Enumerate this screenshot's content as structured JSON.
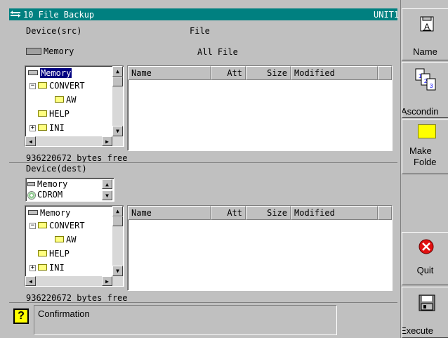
{
  "window": {
    "title": "10 File Backup",
    "unit": "UNIT1"
  },
  "source": {
    "device_label": "Device(src)",
    "file_label": "File",
    "device_value": "Memory",
    "file_value": "All File",
    "tree": [
      "Memory",
      "CONVERT",
      "AW",
      "HELP",
      "INI"
    ],
    "columns": [
      "Name",
      "Att",
      "Size",
      "Modified"
    ],
    "free": "936220672 bytes free"
  },
  "dest": {
    "device_label": "Device(dest)",
    "device_options": [
      "Memory",
      "CDROM"
    ],
    "tree": [
      "Memory",
      "CONVERT",
      "AW",
      "HELP",
      "INI"
    ],
    "columns": [
      "Name",
      "Att",
      "Size",
      "Modified"
    ],
    "free": "936220672 bytes free"
  },
  "status": {
    "message": "Confirmation"
  },
  "softkeys": {
    "name": "Name",
    "ascending": "Ascondin",
    "make_folder_1": "Make",
    "make_folder_2": "Folde",
    "quit": "Quit",
    "execute": "Execute"
  },
  "colors": {
    "titlebar": "#008080",
    "selection": "#000080",
    "folder": "#ffff80"
  }
}
